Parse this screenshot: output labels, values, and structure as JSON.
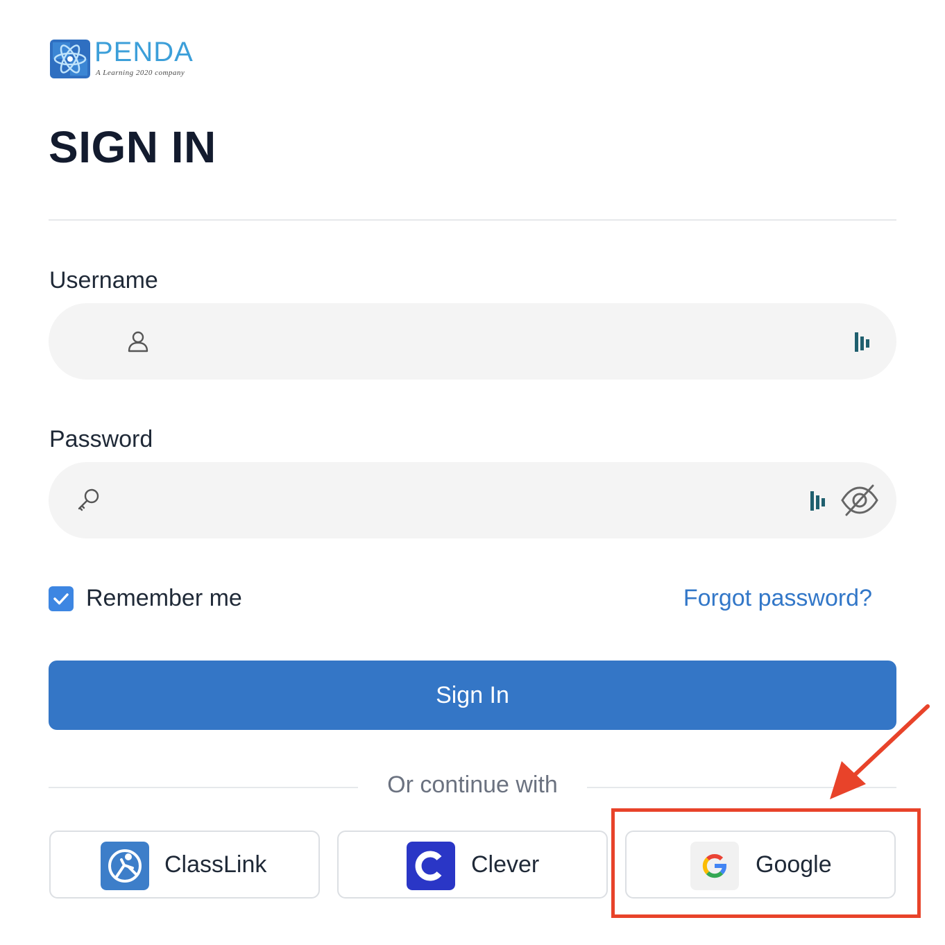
{
  "logo": {
    "name": "PENDA",
    "tagline": "A Learning 2020 company",
    "brand_color": "#3c9fd9"
  },
  "page_title": "SIGN IN",
  "username": {
    "label": "Username",
    "value": "",
    "icon": "user-icon",
    "autofill_icon": "password-manager-icon"
  },
  "password": {
    "label": "Password",
    "value": "",
    "icon": "key-icon",
    "autofill_icon": "password-manager-icon",
    "visibility_icon": "eye-off-icon"
  },
  "remember_me": {
    "label": "Remember me",
    "checked": true
  },
  "forgot_password": "Forgot password?",
  "sign_in_button": "Sign In",
  "divider_text": "Or continue with",
  "sso": [
    {
      "label": "ClassLink",
      "icon": "classlink-icon"
    },
    {
      "label": "Clever",
      "icon": "clever-icon"
    },
    {
      "label": "Google",
      "icon": "google-icon"
    }
  ],
  "colors": {
    "primary": "#3476c6",
    "link": "#3277c8",
    "checkbox": "#3d86e2",
    "annotation": "#e8432a"
  }
}
